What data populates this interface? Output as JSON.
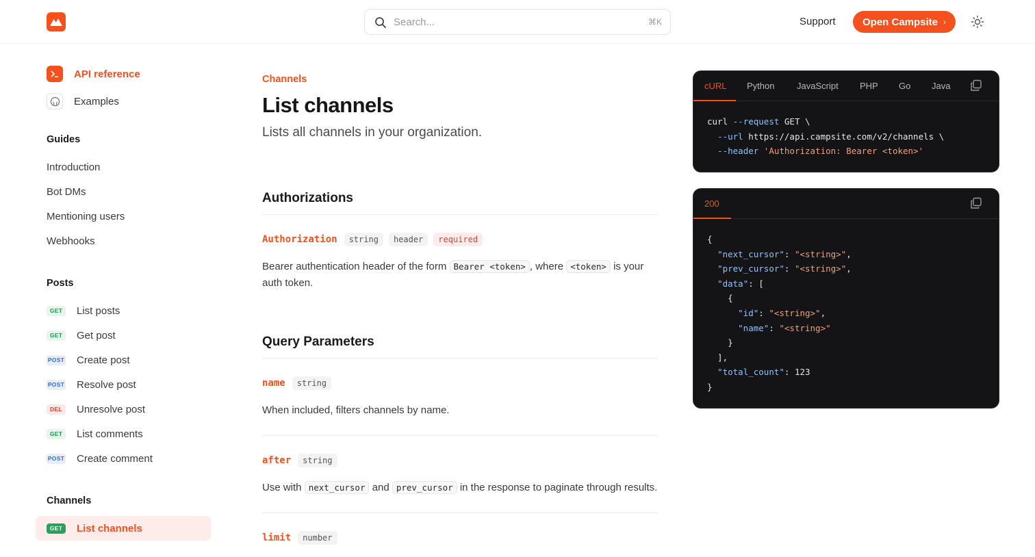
{
  "header": {
    "search_placeholder": "Search...",
    "search_shortcut": "⌘K",
    "support_label": "Support",
    "open_button_label": "Open Campsite",
    "brand_color": "#f4511e"
  },
  "sidebar": {
    "top_links": [
      {
        "label": "API reference",
        "icon": "terminal-icon"
      },
      {
        "label": "Examples",
        "icon": "github-icon"
      }
    ],
    "guides": {
      "heading": "Guides",
      "items": [
        "Introduction",
        "Bot DMs",
        "Mentioning users",
        "Webhooks"
      ]
    },
    "posts": {
      "heading": "Posts",
      "items": [
        {
          "method": "GET",
          "label": "List posts"
        },
        {
          "method": "GET",
          "label": "Get post"
        },
        {
          "method": "POST",
          "label": "Create post"
        },
        {
          "method": "POST",
          "label": "Resolve post"
        },
        {
          "method": "DEL",
          "label": "Unresolve post"
        },
        {
          "method": "GET",
          "label": "List comments"
        },
        {
          "method": "POST",
          "label": "Create comment"
        }
      ]
    },
    "channels": {
      "heading": "Channels",
      "items": [
        {
          "method": "GET",
          "label": "List channels",
          "active": true
        }
      ]
    }
  },
  "main": {
    "breadcrumb": "Channels",
    "title": "List channels",
    "subtitle": "Lists all channels in your organization.",
    "authorizations": {
      "heading": "Authorizations",
      "param": {
        "name": "Authorization",
        "type": "string",
        "location": "header",
        "required": "required",
        "desc_before": "Bearer authentication header of the form ",
        "code1": "Bearer <token>",
        "desc_middle": ", where ",
        "code2": "<token>",
        "desc_after": " is your auth token."
      }
    },
    "query": {
      "heading": "Query Parameters",
      "params": [
        {
          "name": "name",
          "type": "string",
          "desc": "When included, filters channels by name."
        },
        {
          "name": "after",
          "type": "string",
          "desc_before": "Use with ",
          "code1": "next_cursor",
          "desc_middle": " and ",
          "code2": "prev_cursor",
          "desc_after": " in the response to paginate through results."
        },
        {
          "name": "limit",
          "type": "number"
        }
      ]
    }
  },
  "request_panel": {
    "tabs": [
      "cURL",
      "Python",
      "JavaScript",
      "PHP",
      "Go",
      "Java"
    ],
    "active_tab": "cURL",
    "lines": [
      {
        "a": "curl ",
        "b": "--request",
        "c": " GET \\"
      },
      {
        "a": "  ",
        "b": "--url",
        "c": " https://api.campsite.com/v2/channels \\"
      },
      {
        "a": "  ",
        "b": "--header",
        "c": " 'Authorization: Bearer <token>'"
      }
    ]
  },
  "response_panel": {
    "status": "200",
    "lines": [
      "{",
      "  \"next_cursor\": \"<string>\",",
      "  \"prev_cursor\": \"<string>\",",
      "  \"data\": [",
      "    {",
      "      \"id\": \"<string>\",",
      "      \"name\": \"<string>\"",
      "    }",
      "  ],",
      "  \"total_count\": 123",
      "}"
    ]
  }
}
